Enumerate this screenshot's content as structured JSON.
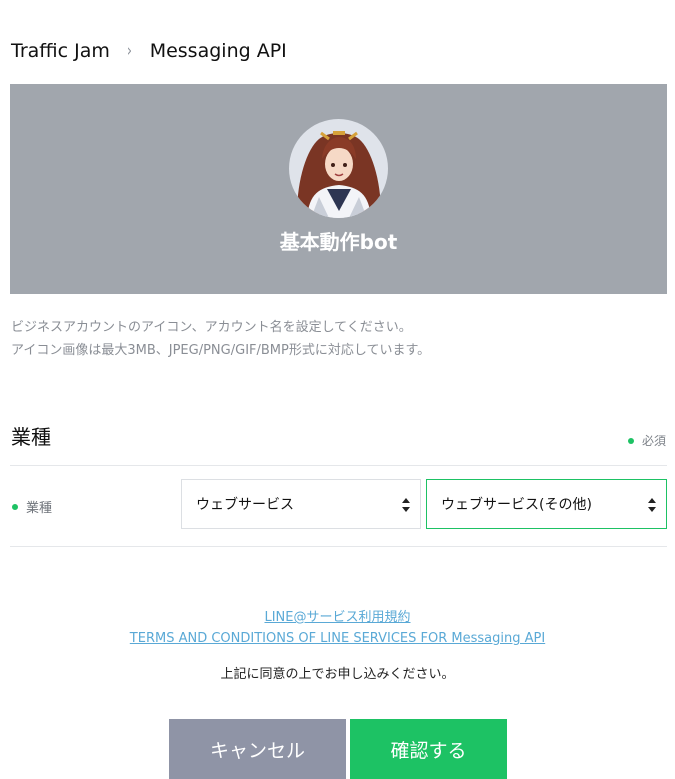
{
  "breadcrumb": {
    "items": [
      "Traffic Jam",
      "Messaging API"
    ],
    "separator": "›"
  },
  "profile": {
    "name": "基本動作bot"
  },
  "description": {
    "line1": "ビジネスアカウントのアイコン、アカウント名を設定してください。",
    "line2": "アイコン画像は最大3MB、JPEG/PNG/GIF/BMP形式に対応しています。"
  },
  "industry_section": {
    "title": "業種",
    "required_label": "必須",
    "field_label": "業種",
    "category_select": {
      "value": "ウェブサービス"
    },
    "subcategory_select": {
      "value": "ウェブサービス(その他)"
    }
  },
  "terms": {
    "link1": "LINE@サービス利用規約",
    "link2": "TERMS AND CONDITIONS OF LINE SERVICES FOR Messaging API",
    "agree_text": "上記に同意の上でお申し込みください。"
  },
  "buttons": {
    "cancel": "キャンセル",
    "confirm": "確認する"
  },
  "colors": {
    "accent_green": "#1dc264",
    "hero_gray": "#a1a6ad",
    "cancel_gray": "#8f94a6",
    "link_blue": "#5aa9d6"
  }
}
